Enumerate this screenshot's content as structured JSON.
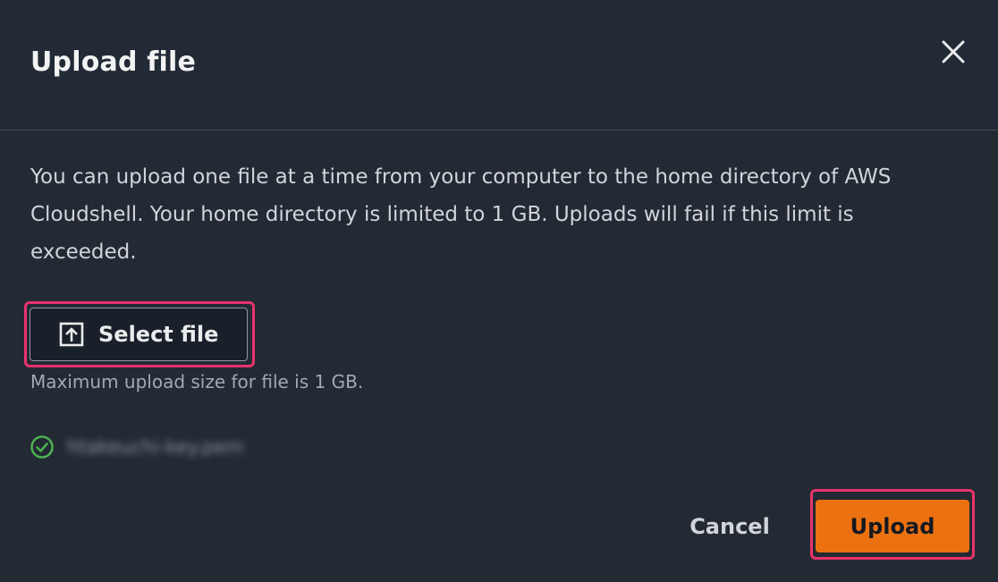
{
  "dialog": {
    "title": "Upload file",
    "close_icon": "close-icon",
    "description": "You can upload one file at a time from your computer to the home directory of AWS Cloudshell. Your home directory is limited to 1 GB. Uploads will fail if this limit is exceeded.",
    "select_button": {
      "label": "Select file",
      "icon": "upload-icon"
    },
    "hint": "Maximum upload size for file is 1 GB.",
    "selected_file": {
      "name": "htakeuchi-key.pem",
      "status_icon": "success-check-icon"
    },
    "actions": {
      "cancel_label": "Cancel",
      "upload_label": "Upload"
    }
  },
  "colors": {
    "background": "#232a33",
    "accent": "#ec7211",
    "highlight": "#e8336d",
    "success": "#4caf50"
  }
}
